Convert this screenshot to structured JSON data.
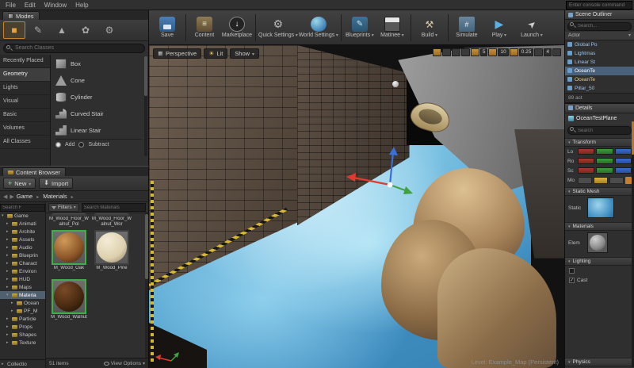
{
  "colors": {
    "accent_orange": "#e8a33d",
    "selection_green": "#3fae4a",
    "axis_x": "#a83a30",
    "axis_y": "#3f9c3f",
    "axis_z": "#3a6cd0",
    "water_blue": "#5aa8d2"
  },
  "menu": {
    "items": [
      "File",
      "Edit",
      "Window",
      "Help"
    ]
  },
  "console": {
    "placeholder": "Enter console command"
  },
  "toolbar": {
    "buttons": [
      {
        "label": "Save"
      },
      {
        "label": "Content"
      },
      {
        "label": "Marketplace"
      },
      {
        "label": "Quick Settings"
      },
      {
        "label": "World Settings"
      },
      {
        "label": "Blueprints"
      },
      {
        "label": "Matinee"
      },
      {
        "label": "Build"
      },
      {
        "label": "Simulate"
      },
      {
        "label": "Play"
      },
      {
        "label": "Launch"
      }
    ]
  },
  "modes": {
    "title": "Modes",
    "search_placeholder": "Search Classes",
    "categories": [
      "Recently Placed",
      "Geometry",
      "Lights",
      "Visual",
      "Basic",
      "Volumes",
      "All Classes"
    ],
    "items": [
      "Box",
      "Cone",
      "Cylinder",
      "Curved Stair",
      "Linear Stair"
    ],
    "add_label": "Add",
    "subtract_label": "Subtract"
  },
  "content_browser": {
    "tab": "Content Browser",
    "new_label": "New",
    "import_label": "Import",
    "breadcrumb": [
      "Game",
      "Materials"
    ],
    "tree_search_placeholder": "Search F",
    "filters_label": "Filters",
    "asset_search_placeholder": "Search Materials",
    "folders": [
      "Game",
      "Animati",
      "Archite",
      "Assets",
      "Audio",
      "Blueprin",
      "Charact",
      "Environ",
      "HUD",
      "Maps",
      "Materia",
      "Ocean",
      "PF_M",
      "Particle",
      "Props",
      "Shapes",
      "Texture"
    ],
    "collections_label": "Collectio",
    "assets": [
      {
        "name": "M_Wood_Floor_Walnut_Pol"
      },
      {
        "name": "M_Wood_Floor_Walnut_Wor"
      },
      {
        "name": "M_Wood_Oak"
      },
      {
        "name": "M_Wood_Pine"
      },
      {
        "name": "M_Wood_Walnut"
      }
    ],
    "status": "51 items",
    "view_options_label": "View Options"
  },
  "viewport": {
    "perspective_label": "Perspective",
    "lit_label": "Lit",
    "show_label": "Show",
    "snap_grid_value": "5",
    "snap_angle_value": "10",
    "snap_scale_value": "0.25",
    "camera_speed_value": "4",
    "level_label": "Level: Example_Map (Persistent)"
  },
  "scene_outliner": {
    "title": "Scene Outliner",
    "search_placeholder": "Search...",
    "column_label": "Actor",
    "items": [
      {
        "label": "Global Po"
      },
      {
        "label": "Lightmas"
      },
      {
        "label": "Linear St"
      },
      {
        "label": "OceanTe"
      },
      {
        "label": "OceanTe"
      },
      {
        "label": "Pillar_50"
      }
    ],
    "status": "89 act"
  },
  "details": {
    "title": "Details",
    "object_name": "OceanTestPlane",
    "search_placeholder": "Search",
    "transform_label": "Transform",
    "location_label": "Lo",
    "rotation_label": "Ro",
    "scale_label": "Sc",
    "mobility_label": "Mo",
    "static_mesh_label": "Static Mesh",
    "static_row_label": "Static",
    "materials_label": "Materials",
    "element_row_label": "Elem",
    "lighting_label": "Lighting",
    "cast_label": "Cast",
    "physics_label": "Physics"
  }
}
